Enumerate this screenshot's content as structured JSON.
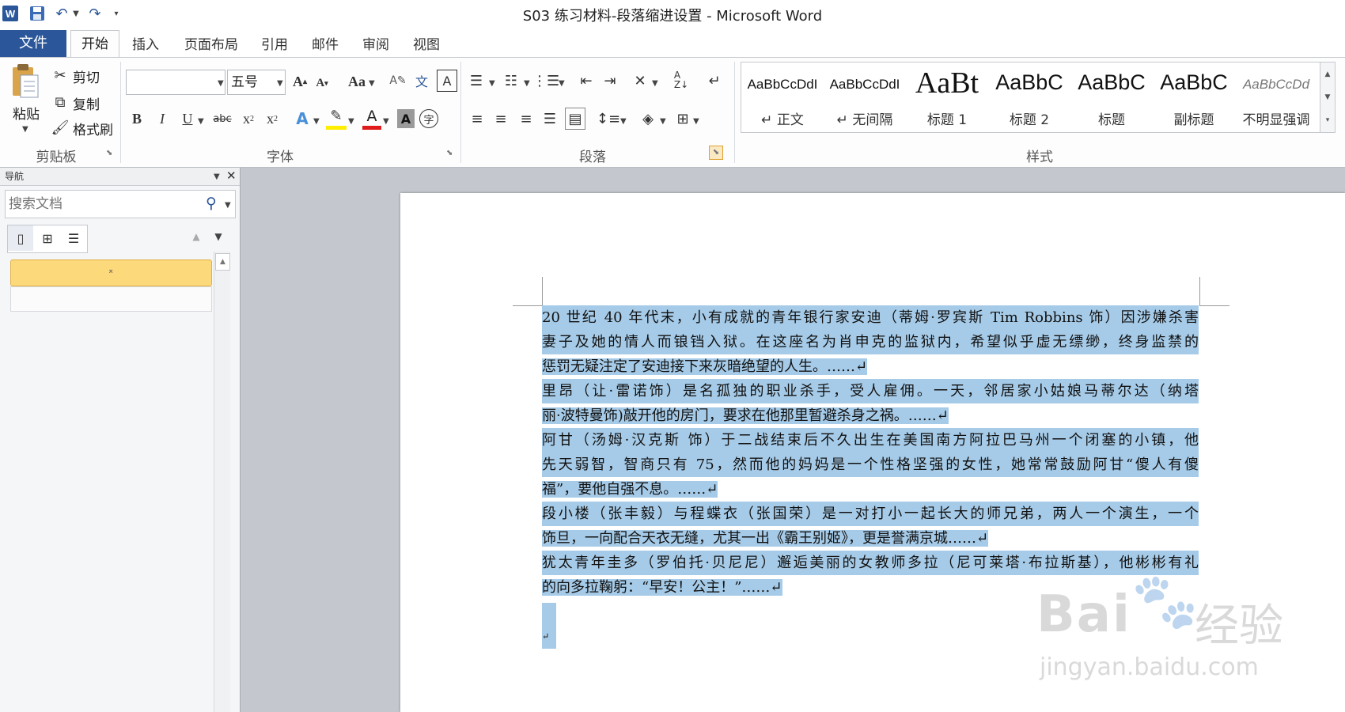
{
  "window": {
    "title": "S03 练习材料-段落缩进设置 - Microsoft Word"
  },
  "quick_access": {
    "app_icon": "word-icon",
    "save_icon": "save-icon",
    "undo_icon": "undo-icon",
    "redo_icon": "redo-icon",
    "customize_icon": "chevron-down-icon"
  },
  "tabs": [
    {
      "label": "文件"
    },
    {
      "label": "开始"
    },
    {
      "label": "插入"
    },
    {
      "label": "页面布局"
    },
    {
      "label": "引用"
    },
    {
      "label": "邮件"
    },
    {
      "label": "审阅"
    },
    {
      "label": "视图"
    }
  ],
  "clipboard": {
    "paste": "粘贴",
    "cut": "剪切",
    "copy": "复制",
    "format_painter": "格式刷",
    "group_label": "剪贴板"
  },
  "font": {
    "family_value": "",
    "size_value": "五号",
    "group_label": "字体",
    "bold": "B",
    "italic": "I",
    "underline": "U",
    "strikethrough": "abc",
    "aa": "Aa"
  },
  "paragraph": {
    "group_label": "段落"
  },
  "styles": {
    "group_label": "样式",
    "items": [
      {
        "sample": "AaBbCcDdI",
        "name": "↵ 正文"
      },
      {
        "sample": "AaBbCcDdI",
        "name": "↵ 无间隔"
      },
      {
        "sample": "AaBt",
        "name": "标题 1"
      },
      {
        "sample": "AaBbC",
        "name": "标题 2"
      },
      {
        "sample": "AaBbC",
        "name": "标题"
      },
      {
        "sample": "AaBbC",
        "name": "副标题"
      },
      {
        "sample": "AaBbCcDd",
        "name": "不明显强调"
      }
    ]
  },
  "nav": {
    "title": "导航",
    "search_placeholder": "搜索文档"
  },
  "document": {
    "paragraphs": [
      {
        "lines": [
          "20 世纪 40 年代末，小有成就的青年银行家安迪（蒂姆·罗宾斯 Tim Robbins 饰）因涉嫌杀害",
          "妻子及她的情人而锒铛入狱。在这座名为肖申克的监狱内，希望似乎虚无缥缈，终身监禁的",
          "惩罚无疑注定了安迪接下来灰暗绝望的人生。……↵"
        ]
      },
      {
        "lines": [
          "里昂（让·雷诺饰）是名孤独的职业杀手，受人雇佣。一天，邻居家小姑娘马蒂尔达（纳塔",
          "丽·波特曼饰)敲开他的房门，要求在他那里暂避杀身之祸。……↵"
        ]
      },
      {
        "lines": [
          "阿甘（汤姆·汉克斯 饰）于二战结束后不久出生在美国南方阿拉巴马州一个闭塞的小镇，他",
          "先天弱智，智商只有 75，然而他的妈妈是一个性格坚强的女性，她常常鼓励阿甘“傻人有傻",
          "福”，要他自强不息。……↵"
        ]
      },
      {
        "lines": [
          "段小楼（张丰毅）与程蝶衣（张国荣）是一对打小一起长大的师兄弟，两人一个演生，一个",
          "饰旦，一向配合天衣无缝，尤其一出《霸王别姬》，更是誉满京城……↵"
        ]
      },
      {
        "lines": [
          "犹太青年圭多（罗伯托·贝尼尼）邂逅美丽的女教师多拉（尼可莱塔·布拉斯基），他彬彬有礼",
          "的向多拉鞠躬：“早安！公主！”……↵"
        ]
      }
    ],
    "empty_mark": "↵"
  },
  "watermark": {
    "text1": "Bai",
    "text2": "经验",
    "url": "jingyan.baidu.com"
  }
}
